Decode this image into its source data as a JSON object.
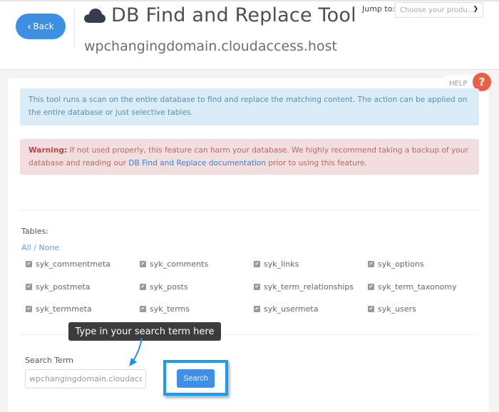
{
  "header": {
    "back_label": "Back",
    "title": "DB Find and Replace Tool",
    "subtitle": "wpchangingdomain.cloudaccess.host",
    "jump_label": "Jump to:",
    "jump_select_placeholder": "Choose your produ...",
    "title_icon": "cloud-icon"
  },
  "help": {
    "label": "HELP",
    "icon_glyph": "?"
  },
  "info": {
    "text": "This tool runs a scan on the entire database to find and replace the matching content. The action can be applied on the entire database or just selective tables."
  },
  "warning": {
    "label": "Warning:",
    "text_before": " If not used properly, this feature can harm your database. We highly recommend taking a backup of your database and reading our ",
    "link_text": "DB Find and Replace documentation",
    "text_after": " prior to using this feature."
  },
  "tables": {
    "label": "Tables:",
    "all_label": "All",
    "separator": "/",
    "none_label": "None",
    "items": [
      {
        "name": "syk_commentmeta",
        "checked": true
      },
      {
        "name": "syk_comments",
        "checked": true
      },
      {
        "name": "syk_links",
        "checked": true
      },
      {
        "name": "syk_options",
        "checked": true
      },
      {
        "name": "syk_postmeta",
        "checked": true
      },
      {
        "name": "syk_posts",
        "checked": true
      },
      {
        "name": "syk_term_relationships",
        "checked": true
      },
      {
        "name": "syk_term_taxonomy",
        "checked": true
      },
      {
        "name": "syk_termmeta",
        "checked": true
      },
      {
        "name": "syk_terms",
        "checked": true
      },
      {
        "name": "syk_usermeta",
        "checked": true
      },
      {
        "name": "syk_users",
        "checked": true
      }
    ]
  },
  "annotation": {
    "tooltip": "Type in your search term here",
    "highlight_color": "#1e9bf0"
  },
  "search": {
    "label": "Search Term",
    "value": "wpchangingdomain.cloudaccess.",
    "button_label": "Search"
  },
  "colors": {
    "primary": "#3c8fe3",
    "help": "#e8604a",
    "info_bg": "#d9ecf7",
    "warning_bg": "#f2dede"
  }
}
